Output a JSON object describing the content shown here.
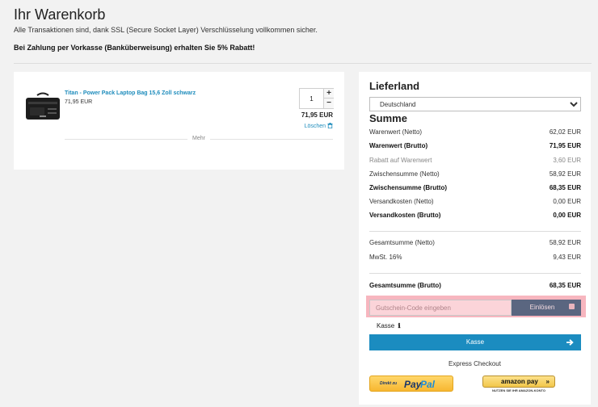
{
  "header": {
    "title": "Ihr Warenkorb",
    "ssl_note": "Alle Transaktionen sind, dank SSL (Secure Socket Layer) Verschlüsselung vollkommen sicher.",
    "discount_note": "Bei Zahlung per Vorkasse (Banküberweisung) erhalten Sie 5% Rabatt!"
  },
  "cart": {
    "items": [
      {
        "name": "Titan - Power Pack Laptop Bag 15,6 Zoll schwarz",
        "unit_price": "71,95 EUR",
        "quantity": "1",
        "line_total": "71,95 EUR",
        "remove_label": "Löschen"
      }
    ],
    "more_label": "Mehr"
  },
  "summary": {
    "country_heading": "Lieferland",
    "country_selected": "Deutschland",
    "totals_heading": "Summe",
    "rows": [
      {
        "label": "Warenwert (Netto)",
        "value": "62,02 EUR"
      },
      {
        "label": "Warenwert (Brutto)",
        "value": "71,95 EUR"
      },
      {
        "label": "Rabatt auf Warenwert",
        "value": "3,60 EUR"
      },
      {
        "label": "Zwischensumme (Netto)",
        "value": "58,92 EUR"
      },
      {
        "label": "Zwischensumme (Brutto)",
        "value": "68,35 EUR"
      },
      {
        "label": "Versandkosten (Netto)",
        "value": "0,00 EUR"
      },
      {
        "label": "Versandkosten (Brutto)",
        "value": "0,00 EUR"
      },
      {
        "label": "Gesamtsumme (Netto)",
        "value": "58,92 EUR"
      },
      {
        "label": "MwSt. 16%",
        "value": "9,43 EUR"
      },
      {
        "label": "Gesamtsumme (Brutto)",
        "value": "68,35 EUR"
      }
    ]
  },
  "coupon": {
    "placeholder": "Gutschein-Code eingeben",
    "redeem_label": "Einlösen"
  },
  "checkout": {
    "kasse_label": "Kasse",
    "button_label": "Kasse",
    "express_label": "Express Checkout",
    "paypal_prefix": "Direkt zu",
    "paypal_pay": "Pay",
    "paypal_pal": "Pal",
    "amazon_label": "amazon pay",
    "amazon_arrows": "»",
    "amazon_sub": "NUTZEN SIE IHR AMAZON-KONTO"
  },
  "icons": {
    "info": "info-icon",
    "trash": "trash-icon",
    "gift": "gift-icon",
    "arrow": "arrow-right-icon"
  },
  "colors": {
    "link": "#1e8cbc",
    "checkout": "#1b8cc0",
    "redeem": "#5a6680",
    "highlight": "#f7b6bf"
  }
}
